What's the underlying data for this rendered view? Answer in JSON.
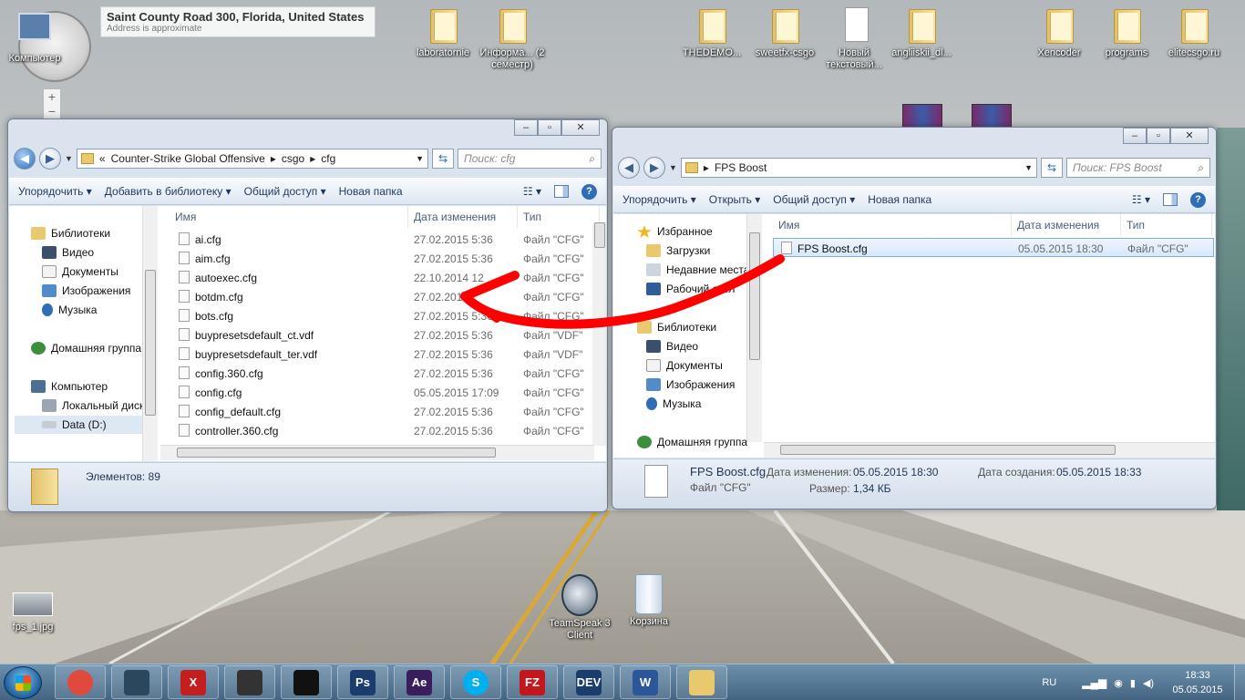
{
  "location_tip": {
    "title": "Saint County Road 300, Florida, United States",
    "subtitle": "Address is approximate"
  },
  "desktop_icons": [
    {
      "label": "Компьютер"
    },
    {
      "label": "laboratornie"
    },
    {
      "label": "Информа... (2 семестр)"
    },
    {
      "label": "THEDEMO..."
    },
    {
      "label": "sweetfx-csgo"
    },
    {
      "label": "Новый текстовый..."
    },
    {
      "label": "angliiskii_dl..."
    },
    {
      "label": "Xencoder"
    },
    {
      "label": "programs"
    },
    {
      "label": "elitecsgo.ru"
    },
    {
      "label": "fps_1.jpg"
    },
    {
      "label": "TeamSpeak 3 Client"
    },
    {
      "label": "Корзина"
    }
  ],
  "zoom_plus": "+",
  "zoom_minus": "−",
  "left_window": {
    "address": {
      "prefix": "«",
      "parts": [
        "Counter-Strike Global Offensive",
        "csgo",
        "cfg"
      ]
    },
    "search_placeholder": "Поиск: cfg",
    "toolbar": [
      "Упорядочить ▾",
      "Добавить в библиотеку ▾",
      "Общий доступ ▾",
      "Новая папка"
    ],
    "nav": [
      "Библиотеки",
      "Видео",
      "Документы",
      "Изображения",
      "Музыка",
      "Домашняя группа",
      "Компьютер",
      "Локальный диск",
      "Data (D:)"
    ],
    "columns": [
      "Имя",
      "Дата изменения",
      "Тип"
    ],
    "files": [
      {
        "name": "ai.cfg",
        "date": "27.02.2015 5:36",
        "type": "Файл \"CFG\""
      },
      {
        "name": "aim.cfg",
        "date": "27.02.2015 5:36",
        "type": "Файл \"CFG\""
      },
      {
        "name": "autoexec.cfg",
        "date": "22.10.2014 12",
        "type": "Файл \"CFG\""
      },
      {
        "name": "botdm.cfg",
        "date": "27.02.2015",
        "type": "Файл \"CFG\""
      },
      {
        "name": "bots.cfg",
        "date": "27.02.2015 5:36",
        "type": "Файл \"CFG\""
      },
      {
        "name": "buypresetsdefault_ct.vdf",
        "date": "27.02.2015 5:36",
        "type": "Файл \"VDF\""
      },
      {
        "name": "buypresetsdefault_ter.vdf",
        "date": "27.02.2015 5:36",
        "type": "Файл \"VDF\""
      },
      {
        "name": "config.360.cfg",
        "date": "27.02.2015 5:36",
        "type": "Файл \"CFG\""
      },
      {
        "name": "config.cfg",
        "date": "05.05.2015 17:09",
        "type": "Файл \"CFG\""
      },
      {
        "name": "config_default.cfg",
        "date": "27.02.2015 5:36",
        "type": "Файл \"CFG\""
      },
      {
        "name": "controller.360.cfg",
        "date": "27.02.2015 5:36",
        "type": "Файл \"CFG\""
      }
    ],
    "status": "Элементов: 89"
  },
  "right_window": {
    "address": {
      "parts": [
        "FPS Boost"
      ]
    },
    "search_placeholder": "Поиск: FPS Boost",
    "toolbar": [
      "Упорядочить ▾",
      "Открыть ▾",
      "Общий доступ ▾",
      "Новая папка"
    ],
    "nav": [
      "Избранное",
      "Загрузки",
      "Недавние места",
      "Рабочий стол",
      "Библиотеки",
      "Видео",
      "Документы",
      "Изображения",
      "Музыка",
      "Домашняя группа"
    ],
    "columns": [
      "Имя",
      "Дата изменения",
      "Тип"
    ],
    "files": [
      {
        "name": "FPS Boost.cfg",
        "date": "05.05.2015 18:30",
        "type": "Файл \"CFG\""
      }
    ],
    "details": {
      "name": "FPS Boost.cfg",
      "type": "Файл \"CFG\"",
      "modified_label": "Дата изменения:",
      "modified": "05.05.2015 18:30",
      "created_label": "Дата создания:",
      "created": "05.05.2015 18:33",
      "size_label": "Размер:",
      "size": "1,34 КБ"
    }
  },
  "taskbar": {
    "apps": [
      {
        "icon": "chrome-icon",
        "color": "#e04a3c",
        "text": ""
      },
      {
        "icon": "steam-icon",
        "color": "#2a475e",
        "text": ""
      },
      {
        "icon": "x-icon",
        "color": "#c41e1e",
        "text": "X"
      },
      {
        "icon": "gear-film-icon",
        "color": "#333333",
        "text": ""
      },
      {
        "icon": "film-icon",
        "color": "#111111",
        "text": ""
      },
      {
        "icon": "photoshop-icon",
        "color": "#1c3c6d",
        "text": "Ps"
      },
      {
        "icon": "aftereffects-icon",
        "color": "#3a1e5c",
        "text": "Ae"
      },
      {
        "icon": "skype-icon",
        "color": "#00aff0",
        "text": "S"
      },
      {
        "icon": "filezilla-icon",
        "color": "#c4161c",
        "text": "FZ"
      },
      {
        "icon": "devcpp-icon",
        "color": "#1b3d6e",
        "text": "DEV"
      },
      {
        "icon": "word-icon",
        "color": "#2b579a",
        "text": "W"
      },
      {
        "icon": "explorer-icon",
        "color": "#e9c86e",
        "text": ""
      }
    ],
    "lang": "RU",
    "time": "18:33",
    "date": "05.05.2015"
  },
  "colors": {
    "accent": "#2f6db5",
    "arrow": "#ff0000"
  }
}
